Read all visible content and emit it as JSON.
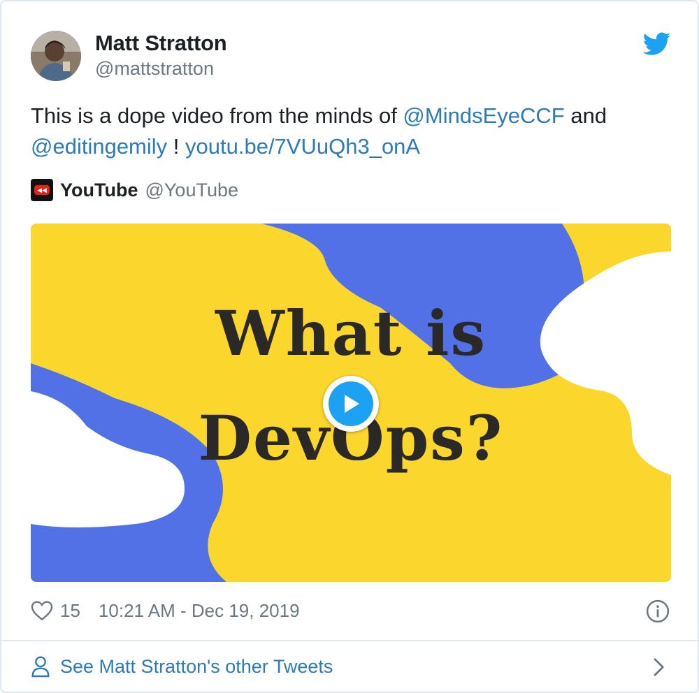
{
  "author": {
    "name": "Matt Stratton",
    "handle": "@mattstratton",
    "avatar_icon": "avatar-photo"
  },
  "tweet": {
    "text_part1": "This is a dope video from the minds of ",
    "mention1": "@MindsEyeCCF",
    "text_part2": " and ",
    "mention2": "@editingemily",
    "text_part3": " ! ",
    "link": "youtu.be/7VUuQh3_onA"
  },
  "card": {
    "source_name": "YouTube",
    "source_handle": "@YouTube",
    "video_title_line1": "What is",
    "video_title_line2": "DevOps?"
  },
  "meta": {
    "likes": "15",
    "timestamp": "10:21 AM - Dec 19, 2019"
  },
  "footer": {
    "other_tweets_label": "See Matt Stratton's other Tweets"
  },
  "colors": {
    "link": "#2b7bb9",
    "twitter_blue": "#1da1f2",
    "muted": "#697882",
    "video_yellow": "#fbd62d",
    "video_blue": "#5371e6"
  }
}
